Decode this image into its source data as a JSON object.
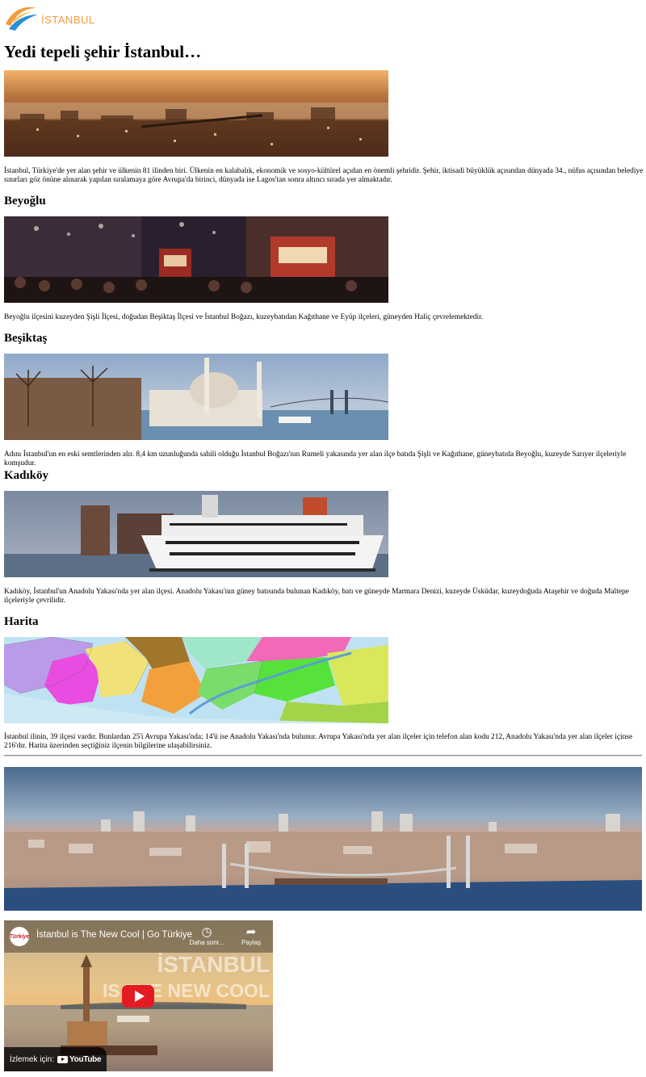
{
  "header": {
    "logo_text": "İSTANBUL"
  },
  "page_title": "Yedi tepeli şehir İstanbul…",
  "sections": [
    {
      "heading": "",
      "text": "İstanbul, Türkiye'de yer alan şehir ve ülkenin 81 ilinden biri. Ülkenin en kalabalık, ekonomik ve sosyo-kültürel açıdan en önemli şehridir. Şehir, iktisadi büyüklük açısından dünyada 34., nüfus açısından belediye sınırları göz önüne alınarak yapılan sıralamaya göre Avrupa'da birinci, dünyada ise Lagos'tan sonra altıncı sırada yer almaktadır."
    },
    {
      "heading": "Beyoğlu",
      "text": "Beyoğlu ilçesini kuzeyden Şişli İlçesi, doğudan Beşiktaş İlçesi ve İstanbul Boğazı, kuzeybatıdan Kağıthane ve Eyüp ilçeleri, güneyden Haliç çevrelemektedir."
    },
    {
      "heading": "Beşiktaş",
      "text": "Adını İstanbul'un en eski semtlerinden alır. 8,4 km uzunluğunda sahili olduğu İstanbul Boğazı'nın Rumeli yakasında yer alan ilçe batıda Şişli ve Kağıthane, güneybatıda Beyoğlu, kuzeyde Sarıyer ilçeleriyle komşudur."
    },
    {
      "heading": "Kadıköy",
      "text": "Kadıköy, İstanbul'un Anadolu Yakası'nda yer alan ilçesi. Anadolu Yakası'nın güney batısında bulunan Kadıköy, batı ve güneyde Marmara Denizi, kuzeyde Üsküdar, kuzeydoğuda Ataşehir ve doğuda Maltepe ilçeleriyle çevrilidir."
    },
    {
      "heading": "Harita",
      "text": "İstanbul ilinin, 39 ilçesi vardır. Bunlardan 25'i Avrupa Yakası'nda; 14'ü ise Anadolu Yakası'nda bulunur. Avrupa Yakası'nda yer alan ilçeler için telefon alan kodu 212, Anadolu Yakası'nda yer alan ilçeler içinse 216'dır. Harita üzerinden seçtiğiniz ilçenin bilgilerine ulaşabilirsiniz."
    }
  ],
  "video": {
    "title": "İstanbul is The New Cool | Go Türkiye",
    "channel_badge": "Türkiye",
    "watch_later_label": "Daha sonr...",
    "share_label": "Paylaş",
    "overlay_line1": "İSTANBUL",
    "overlay_line2": "IS THE NEW COOL",
    "watch_on_label": "İzlemek için:",
    "youtube_label": "YouTube"
  },
  "colors": {
    "logo_accent": "#f29a3b",
    "logo_swoosh_blue": "#2a8fd6",
    "play_button": "#e31c23",
    "divider": "#8a8a8a"
  },
  "icons": [
    "logo-swoosh-icon",
    "clock-icon",
    "share-icon",
    "play-icon",
    "youtube-icon"
  ]
}
